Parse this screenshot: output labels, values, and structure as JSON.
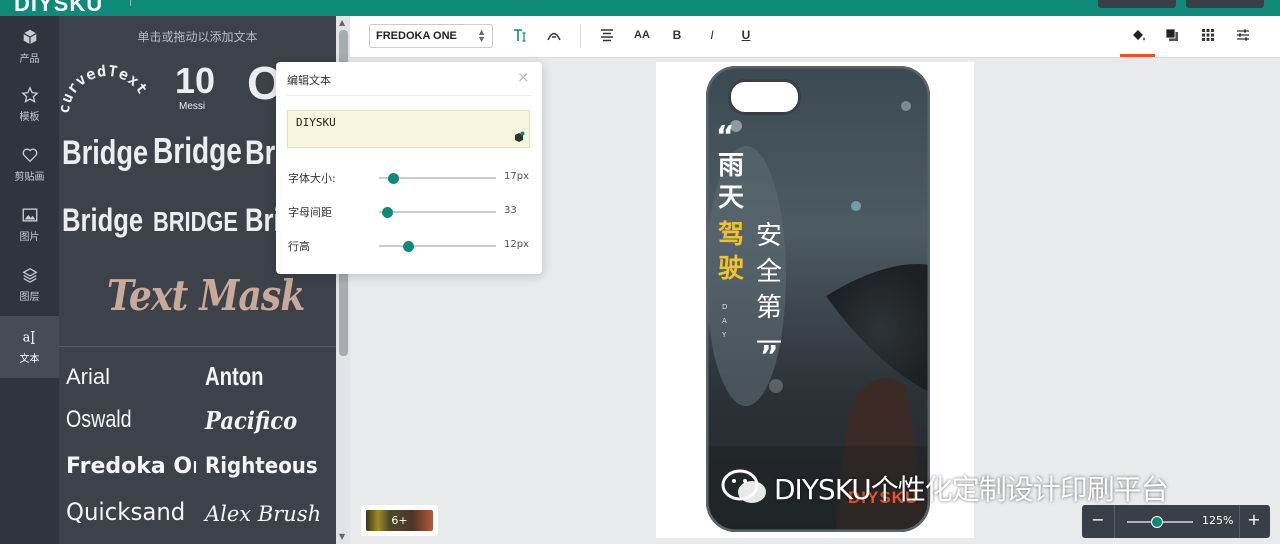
{
  "app": {
    "logo": "DIYSKU"
  },
  "rail": {
    "items": [
      {
        "label": "产品",
        "icon": "cube-icon"
      },
      {
        "label": "模板",
        "icon": "star-icon"
      },
      {
        "label": "剪贴画",
        "icon": "heart-icon"
      },
      {
        "label": "图片",
        "icon": "image-icon"
      },
      {
        "label": "图层",
        "icon": "layers-icon"
      },
      {
        "label": "文本",
        "icon": "text-tool-icon",
        "active": true
      }
    ]
  },
  "text_panel": {
    "hint": "单击或拖动以添加文本",
    "samples": [
      "curvedText",
      "10",
      "Messi",
      "Ob",
      "Bridge",
      "Bridge",
      "Bri",
      "Bridge",
      "BRIDGE",
      "Bri",
      "Text Mask"
    ],
    "fonts": [
      "Arial",
      "Anton",
      "Oswald",
      "Pacifico",
      "Fredoka One",
      "Righteous",
      "Quicksand",
      "Alex Brush"
    ]
  },
  "toolbar": {
    "font": "FREDOKA ONE",
    "buttons": [
      "text-style-icon",
      "curve-text-icon",
      "align-center-icon",
      "font-size-icon",
      "bold-icon",
      "italic-icon",
      "underline-icon",
      "fill-color-icon",
      "shadow-icon",
      "pattern-icon",
      "adjust-icon"
    ],
    "font_size_label": "AA",
    "bold": "B",
    "italic": "I",
    "underline": "U"
  },
  "edit_popup": {
    "title": "编辑文本",
    "close": "×",
    "text": "DIYSKU",
    "sliders": [
      {
        "label": "字体大小:",
        "value": "17px",
        "fraction": 0.12
      },
      {
        "label": "字母间距",
        "value": "33",
        "fraction": 0.07
      },
      {
        "label": "行高",
        "value": "12px",
        "fraction": 0.25
      }
    ]
  },
  "design": {
    "quote_open": "“",
    "line1": "雨天",
    "line1b": "驾驶",
    "line2": "安全第一",
    "quote_close": "”",
    "small": "D A Y",
    "brand": "DIYSKU"
  },
  "colors_badge": "6+",
  "zoom": {
    "minus": "−",
    "value": "125%",
    "plus": "+",
    "level": 0.45
  },
  "watermark": "DIYSKU个性化定制设计印刷平台",
  "colors": {
    "teal": "#0f8a7a",
    "orange": "#e8532a",
    "yellow": "#f2c12e"
  }
}
